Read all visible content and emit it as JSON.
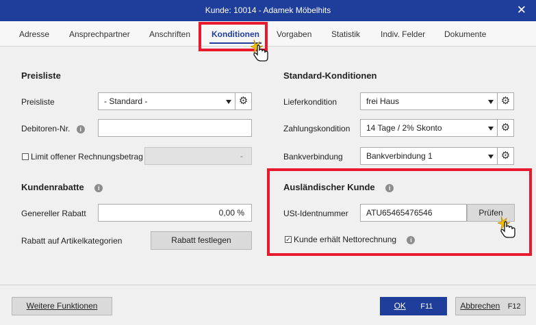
{
  "window": {
    "title": "Kunde: 10014 - Adamek Möbelhits",
    "close_symbol": "✕"
  },
  "tabs": [
    {
      "label": "Adresse"
    },
    {
      "label": "Ansprechpartner"
    },
    {
      "label": "Anschriften"
    },
    {
      "label": "Konditionen",
      "active": true
    },
    {
      "label": "Vorgaben"
    },
    {
      "label": "Statistik"
    },
    {
      "label": "Indiv. Felder"
    },
    {
      "label": "Dokumente"
    }
  ],
  "preisliste": {
    "heading": "Preisliste",
    "preisliste_label": "Preisliste",
    "preisliste_value": "- Standard -",
    "debitoren_label": "Debitoren-Nr.",
    "debitoren_value": "",
    "limit_label": "Limit offener Rechnungsbetrag",
    "limit_value": "-",
    "limit_checked": false
  },
  "kundenrabatte": {
    "heading": "Kundenrabatte",
    "genereller_label": "Genereller Rabatt",
    "genereller_value": "0,00 %",
    "artikel_label": "Rabatt auf Artikelkategorien",
    "rabatt_button": "Rabatt festlegen"
  },
  "standard": {
    "heading": "Standard-Konditionen",
    "liefer_label": "Lieferkondition",
    "liefer_value": "frei Haus",
    "zahlung_label": "Zahlungskondition",
    "zahlung_value": "14 Tage / 2% Skonto",
    "bank_label": "Bankverbindung",
    "bank_value": "Bankverbindung 1"
  },
  "auslaendisch": {
    "heading": "Ausländischer Kunde",
    "ust_label": "USt-Identnummer",
    "ust_value": "ATU65465476546",
    "pruefen_button": "Prüfen",
    "netto_label": "Kunde erhält Nettorechnung",
    "netto_checked": true
  },
  "footer": {
    "weitere_button": "Weitere Funktionen",
    "ok_label": "OK",
    "ok_shortcut": "F11",
    "abbrechen_label": "Abbrechen",
    "abbrechen_shortcut": "F12"
  },
  "icons": {
    "info": "i",
    "gear": "⚙",
    "check": "✓"
  },
  "colors": {
    "accent": "#1f3d9a",
    "highlight": "#e8192c"
  }
}
